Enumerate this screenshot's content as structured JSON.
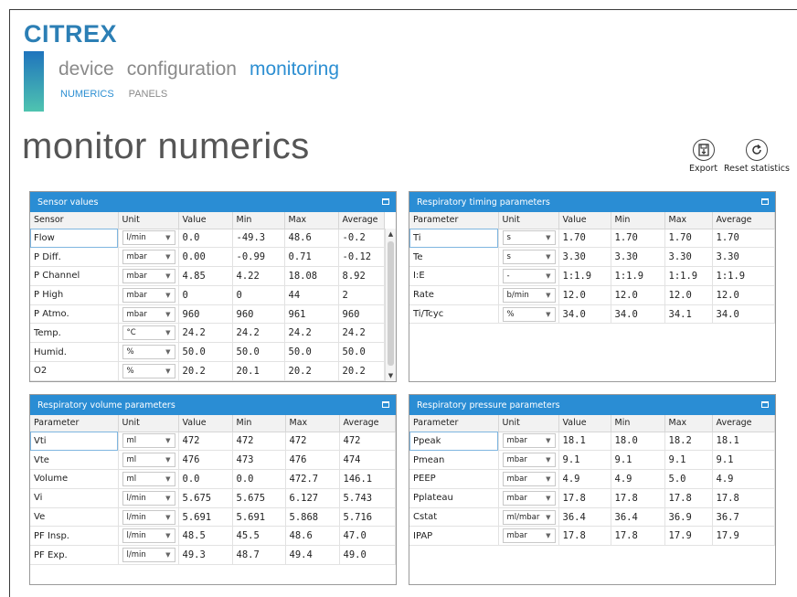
{
  "app": {
    "logo": "CITREX"
  },
  "nav": {
    "tabs": [
      "device",
      "configuration",
      "monitoring"
    ],
    "active": "monitoring"
  },
  "subnav": {
    "tabs": [
      "NUMERICS",
      "PANELS"
    ],
    "active": "NUMERICS"
  },
  "page": {
    "title": "monitor numerics"
  },
  "toolbar": {
    "export_label": "Export",
    "reset_label": "Reset statistics"
  },
  "panels": {
    "sensor": {
      "title": "Sensor values",
      "columns": [
        "Sensor",
        "Unit",
        "Value",
        "Min",
        "Max",
        "Average"
      ],
      "rows": [
        {
          "name": "Flow",
          "unit": "l/min",
          "value": "0.0",
          "min": "-49.3",
          "max": "48.6",
          "avg": "-0.2"
        },
        {
          "name": "P Diff.",
          "unit": "mbar",
          "value": "0.00",
          "min": "-0.99",
          "max": "0.71",
          "avg": "-0.12"
        },
        {
          "name": "P Channel",
          "unit": "mbar",
          "value": "4.85",
          "min": "4.22",
          "max": "18.08",
          "avg": "8.92"
        },
        {
          "name": "P High",
          "unit": "mbar",
          "value": "0",
          "min": "0",
          "max": "44",
          "avg": "2"
        },
        {
          "name": "P Atmo.",
          "unit": "mbar",
          "value": "960",
          "min": "960",
          "max": "961",
          "avg": "960"
        },
        {
          "name": "Temp.",
          "unit": "°C",
          "value": "24.2",
          "min": "24.2",
          "max": "24.2",
          "avg": "24.2"
        },
        {
          "name": "Humid.",
          "unit": "%",
          "value": "50.0",
          "min": "50.0",
          "max": "50.0",
          "avg": "50.0"
        },
        {
          "name": "O2",
          "unit": "%",
          "value": "20.2",
          "min": "20.1",
          "max": "20.2",
          "avg": "20.2"
        }
      ]
    },
    "timing": {
      "title": "Respiratory timing parameters",
      "columns": [
        "Parameter",
        "Unit",
        "Value",
        "Min",
        "Max",
        "Average"
      ],
      "rows": [
        {
          "name": "Ti",
          "unit": "s",
          "value": "1.70",
          "min": "1.70",
          "max": "1.70",
          "avg": "1.70"
        },
        {
          "name": "Te",
          "unit": "s",
          "value": "3.30",
          "min": "3.30",
          "max": "3.30",
          "avg": "3.30"
        },
        {
          "name": "I:E",
          "unit": "-",
          "value": "1:1.9",
          "min": "1:1.9",
          "max": "1:1.9",
          "avg": "1:1.9"
        },
        {
          "name": "Rate",
          "unit": "b/min",
          "value": "12.0",
          "min": "12.0",
          "max": "12.0",
          "avg": "12.0"
        },
        {
          "name": "Ti/Tcyc",
          "unit": "%",
          "value": "34.0",
          "min": "34.0",
          "max": "34.1",
          "avg": "34.0"
        }
      ]
    },
    "volume": {
      "title": "Respiratory volume parameters",
      "columns": [
        "Parameter",
        "Unit",
        "Value",
        "Min",
        "Max",
        "Average"
      ],
      "rows": [
        {
          "name": "Vti",
          "unit": "ml",
          "value": "472",
          "min": "472",
          "max": "472",
          "avg": "472"
        },
        {
          "name": "Vte",
          "unit": "ml",
          "value": "476",
          "min": "473",
          "max": "476",
          "avg": "474"
        },
        {
          "name": "Volume",
          "unit": "ml",
          "value": "0.0",
          "min": "0.0",
          "max": "472.7",
          "avg": "146.1"
        },
        {
          "name": "Vi",
          "unit": "l/min",
          "value": "5.675",
          "min": "5.675",
          "max": "6.127",
          "avg": "5.743"
        },
        {
          "name": "Ve",
          "unit": "l/min",
          "value": "5.691",
          "min": "5.691",
          "max": "5.868",
          "avg": "5.716"
        },
        {
          "name": "PF Insp.",
          "unit": "l/min",
          "value": "48.5",
          "min": "45.5",
          "max": "48.6",
          "avg": "47.0"
        },
        {
          "name": "PF Exp.",
          "unit": "l/min",
          "value": "49.3",
          "min": "48.7",
          "max": "49.4",
          "avg": "49.0"
        }
      ]
    },
    "pressure": {
      "title": "Respiratory pressure parameters",
      "columns": [
        "Parameter",
        "Unit",
        "Value",
        "Min",
        "Max",
        "Average"
      ],
      "rows": [
        {
          "name": "Ppeak",
          "unit": "mbar",
          "value": "18.1",
          "min": "18.0",
          "max": "18.2",
          "avg": "18.1"
        },
        {
          "name": "Pmean",
          "unit": "mbar",
          "value": "9.1",
          "min": "9.1",
          "max": "9.1",
          "avg": "9.1"
        },
        {
          "name": "PEEP",
          "unit": "mbar",
          "value": "4.9",
          "min": "4.9",
          "max": "5.0",
          "avg": "4.9"
        },
        {
          "name": "Pplateau",
          "unit": "mbar",
          "value": "17.8",
          "min": "17.8",
          "max": "17.8",
          "avg": "17.8"
        },
        {
          "name": "Cstat",
          "unit": "ml/mbar",
          "value": "36.4",
          "min": "36.4",
          "max": "36.9",
          "avg": "36.7"
        },
        {
          "name": "IPAP",
          "unit": "mbar",
          "value": "17.8",
          "min": "17.8",
          "max": "17.9",
          "avg": "17.9"
        }
      ]
    }
  },
  "colors": {
    "accent": "#2a8dd4",
    "logo": "#2c7fb5",
    "nav_inactive": "#8a8a8a"
  }
}
